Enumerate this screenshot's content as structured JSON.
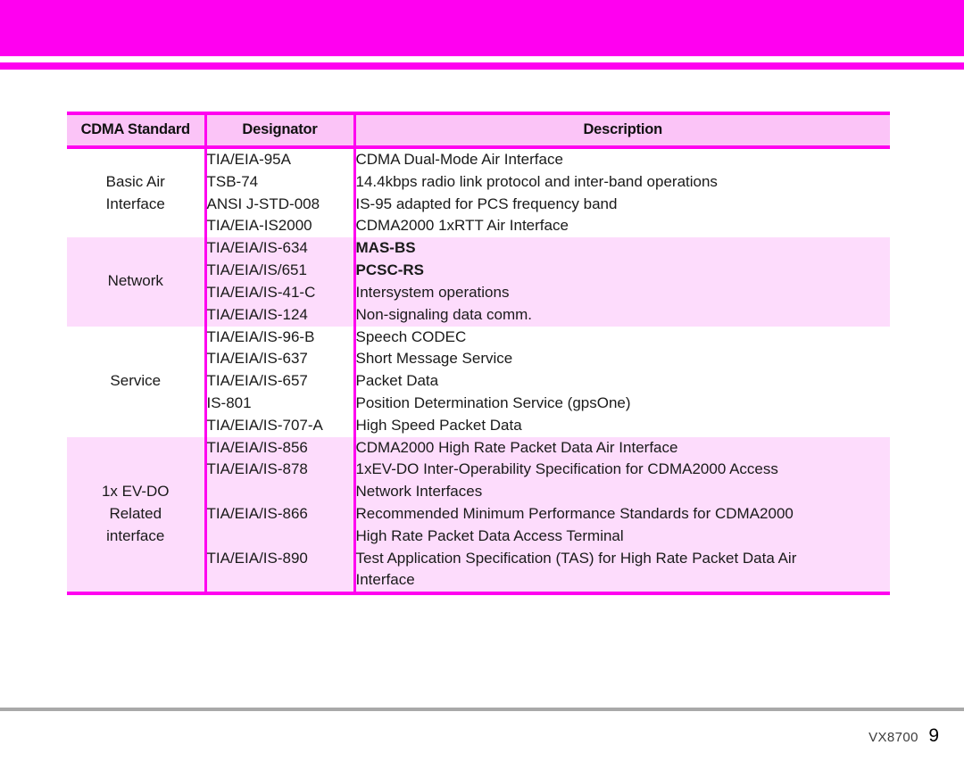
{
  "page": {
    "banner_color": "#ff00f0",
    "accent_color": "#ff00f0",
    "header_bg": "#fbc4f7",
    "alt_row_bg": "#fddcfc"
  },
  "table": {
    "columns": [
      "CDMA Standard",
      "Designator",
      "Description"
    ],
    "rows": [
      {
        "standard": [
          "Basic Air",
          "Interface"
        ],
        "designators": [
          "TIA/EIA-95A",
          "TSB-74",
          "ANSI J-STD-008",
          "TIA/EIA-IS2000"
        ],
        "descriptions": [
          {
            "text": "CDMA Dual-Mode Air Interface",
            "bold": false
          },
          {
            "text": "14.4kbps radio link protocol and inter-band operations",
            "bold": false
          },
          {
            "text": "IS-95 adapted for PCS frequency band",
            "bold": false
          },
          {
            "text": "CDMA2000 1xRTT Air Interface",
            "bold": false
          }
        ],
        "shaded": false
      },
      {
        "standard": [
          "Network"
        ],
        "designators": [
          "TIA/EIA/IS-634",
          "TIA/EIA/IS/651",
          "TIA/EIA/IS-41-C",
          "TIA/EIA/IS-124"
        ],
        "descriptions": [
          {
            "text": "MAS-BS",
            "bold": true
          },
          {
            "text": "PCSC-RS",
            "bold": true
          },
          {
            "text": "Intersystem operations",
            "bold": false
          },
          {
            "text": "Non-signaling data comm.",
            "bold": false
          }
        ],
        "shaded": true
      },
      {
        "standard": [
          "Service"
        ],
        "designators": [
          "TIA/EIA/IS-96-B",
          "TIA/EIA/IS-637",
          "TIA/EIA/IS-657",
          "IS-801",
          "TIA/EIA/IS-707-A"
        ],
        "descriptions": [
          {
            "text": "Speech CODEC",
            "bold": false
          },
          {
            "text": "Short Message Service",
            "bold": false
          },
          {
            "text": "Packet Data",
            "bold": false
          },
          {
            "text": "Position Determination Service (gpsOne)",
            "bold": false
          },
          {
            "text": "High Speed Packet Data",
            "bold": false
          }
        ],
        "shaded": false
      },
      {
        "standard": [
          "1x EV-DO",
          "Related",
          "interface"
        ],
        "designators": [
          "TIA/EIA/IS-856",
          "TIA/EIA/IS-878",
          "",
          "TIA/EIA/IS-866",
          "",
          "TIA/EIA/IS-890",
          ""
        ],
        "descriptions": [
          {
            "text": "CDMA2000 High Rate Packet Data Air Interface",
            "bold": false
          },
          {
            "text": "1xEV-DO Inter-Operability Specification for CDMA2000 Access",
            "bold": false
          },
          {
            "text": "Network Interfaces",
            "bold": false
          },
          {
            "text": "Recommended Minimum Performance Standards for CDMA2000",
            "bold": false
          },
          {
            "text": "High Rate Packet Data Access Terminal",
            "bold": false
          },
          {
            "text": "Test Application Specification (TAS) for High Rate Packet Data Air",
            "bold": false
          },
          {
            "text": "Interface",
            "bold": false
          }
        ],
        "shaded": true
      }
    ]
  },
  "footer": {
    "model": "VX8700",
    "page_number": "9"
  }
}
